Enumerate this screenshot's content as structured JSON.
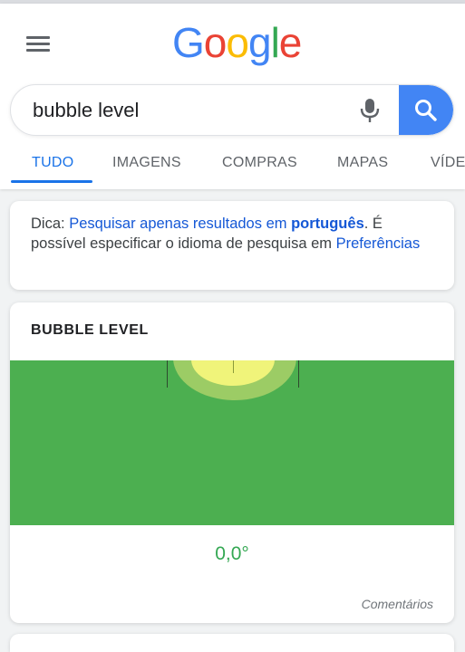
{
  "logo": {
    "letters": [
      "G",
      "o",
      "o",
      "g",
      "l",
      "e"
    ],
    "colors": [
      "#4285f4",
      "#ea4335",
      "#fbbc05",
      "#4285f4",
      "#34a853",
      "#ea4335"
    ]
  },
  "search": {
    "query": "bubble level",
    "button_color": "#4285f4"
  },
  "tabs": [
    {
      "label": "TUDO",
      "active": true
    },
    {
      "label": "IMAGENS",
      "active": false
    },
    {
      "label": "COMPRAS",
      "active": false
    },
    {
      "label": "MAPAS",
      "active": false
    },
    {
      "label": "VÍDE",
      "active": false
    }
  ],
  "tip": {
    "prefix": "Dica: ",
    "link_text": "Pesquisar apenas resultados em ",
    "link_bold": "português",
    "middle": ". É possível especificar o idioma de pesquisa em ",
    "prefs_link": "Preferências"
  },
  "level": {
    "title": "BUBBLE LEVEL",
    "angle": "0,0°",
    "feedback": "Comentários",
    "background_color": "#4caf50",
    "readout_color": "#34a853"
  }
}
